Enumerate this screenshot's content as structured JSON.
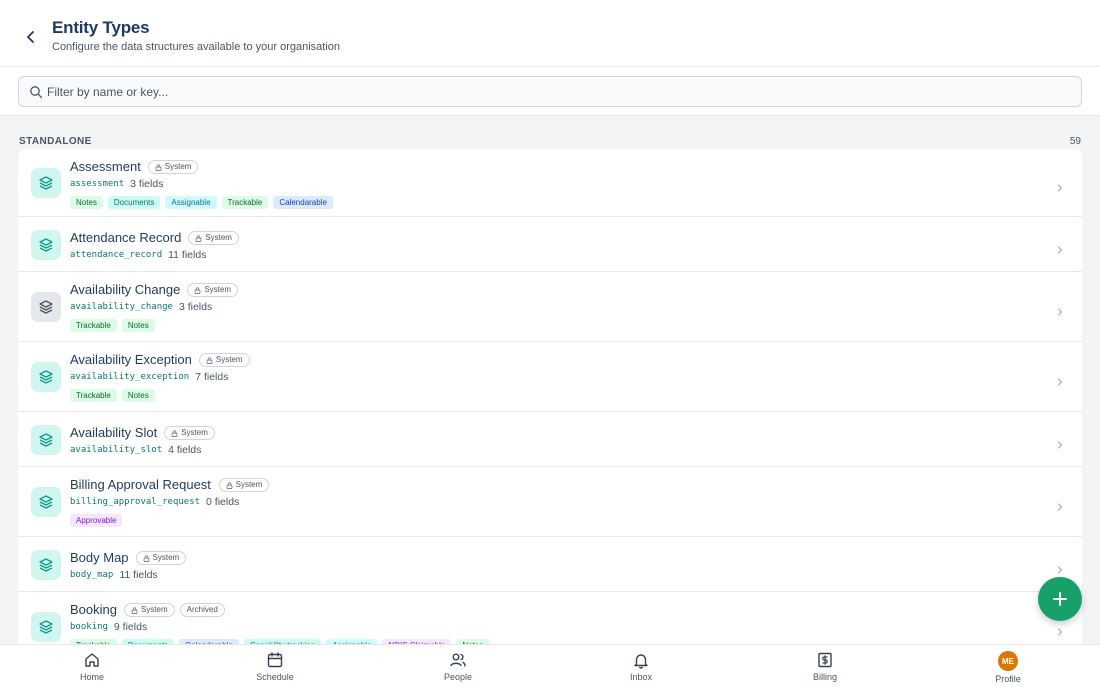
{
  "header": {
    "title": "Entity Types",
    "subtitle": "Configure the data structures available to your organisation"
  },
  "search": {
    "placeholder": "Filter by name or key..."
  },
  "section": {
    "label": "STANDALONE",
    "count": "59"
  },
  "rows": [
    {
      "name": "Assessment",
      "badges": [
        "System"
      ],
      "key": "assessment",
      "fields": "3 fields",
      "tags": [
        {
          "label": "Notes",
          "style": "green"
        },
        {
          "label": "Documents",
          "style": "teal"
        },
        {
          "label": "Assignable",
          "style": "cyan"
        },
        {
          "label": "Trackable",
          "style": "green"
        },
        {
          "label": "Calendarable",
          "style": "blue"
        }
      ]
    },
    {
      "name": "Attendance Record",
      "badges": [
        "System"
      ],
      "key": "attendance_record",
      "fields": "11 fields",
      "tags": []
    },
    {
      "name": "Availability Change",
      "badges": [
        "System"
      ],
      "key": "availability_change",
      "fields": "3 fields",
      "tags": [
        {
          "label": "Trackable",
          "style": "green"
        },
        {
          "label": "Notes",
          "style": "green"
        }
      ],
      "icon_style": "gray"
    },
    {
      "name": "Availability Exception",
      "badges": [
        "System"
      ],
      "key": "availability_exception",
      "fields": "7 fields",
      "tags": [
        {
          "label": "Trackable",
          "style": "green"
        },
        {
          "label": "Notes",
          "style": "green"
        }
      ]
    },
    {
      "name": "Availability Slot",
      "badges": [
        "System"
      ],
      "key": "availability_slot",
      "fields": "4 fields",
      "tags": []
    },
    {
      "name": "Billing Approval Request",
      "badges": [
        "System"
      ],
      "key": "billing_approval_request",
      "fields": "0 fields",
      "tags": [
        {
          "label": "Approvable",
          "style": "purple"
        }
      ]
    },
    {
      "name": "Body Map",
      "badges": [
        "System"
      ],
      "key": "body_map",
      "fields": "11 fields",
      "tags": []
    },
    {
      "name": "Booking",
      "badges": [
        "System",
        "Archived"
      ],
      "key": "booking",
      "fields": "9 fields",
      "tags": [
        {
          "label": "Trackable",
          "style": "green"
        },
        {
          "label": "Documents",
          "style": "teal"
        },
        {
          "label": "Calendarable",
          "style": "blue"
        },
        {
          "label": "Capability tracking",
          "style": "teal"
        },
        {
          "label": "Assignable",
          "style": "cyan"
        },
        {
          "label": "NDIS Claimable",
          "style": "purple"
        },
        {
          "label": "Notes",
          "style": "green"
        }
      ]
    }
  ],
  "nav": [
    {
      "label": "Home",
      "icon": "home-icon"
    },
    {
      "label": "Schedule",
      "icon": "calendar-icon"
    },
    {
      "label": "People",
      "icon": "people-icon"
    },
    {
      "label": "Inbox",
      "icon": "bell-icon"
    },
    {
      "label": "Billing",
      "icon": "billing-icon"
    },
    {
      "label": "Profile",
      "icon": "avatar",
      "initials": "ME"
    }
  ],
  "colors": {
    "accent": "#18a06b",
    "title": "#1e3a5f",
    "avatar": "#d97706"
  }
}
